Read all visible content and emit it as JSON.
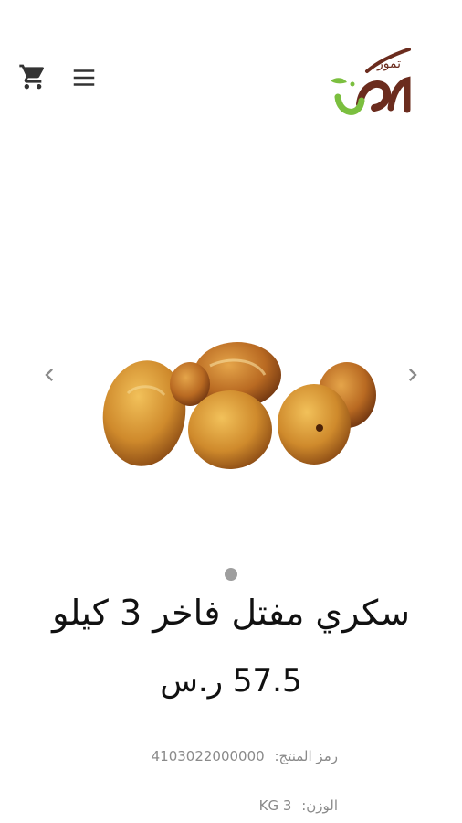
{
  "header": {
    "logo_main": "مكة",
    "logo_sub": "تمور",
    "cart_icon": "cart-icon",
    "menu_icon": "menu-icon"
  },
  "gallery": {
    "prev_icon": "chevron-left-icon",
    "next_icon": "chevron-right-icon",
    "slide_count": 1,
    "active_slide": 1
  },
  "product": {
    "title": "سكري مفتل فاخر 3 كيلو",
    "price": "57.5 ر.س",
    "sku_label": "رمز المنتج:",
    "sku_value": "4103022000000",
    "weight_label": "الوزن:",
    "weight_value": "3 KG"
  },
  "colors": {
    "logo_brown": "#6b2c1e",
    "logo_green": "#7bbf3f",
    "date_fill": "#c9852a",
    "text_muted": "#8a8a8a"
  }
}
